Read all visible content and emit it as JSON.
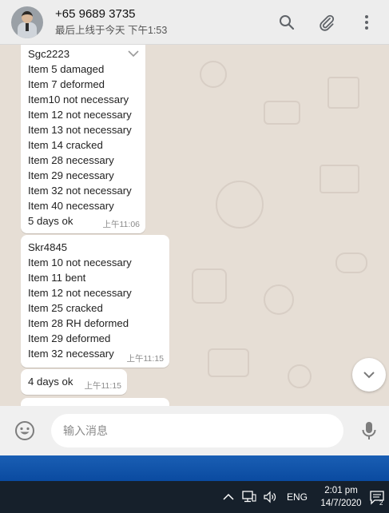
{
  "header": {
    "contact_name": "+65 9689 3735",
    "status": "最后上线于今天 下午1:53",
    "icons": [
      "search-icon",
      "attach-icon",
      "menu-icon"
    ]
  },
  "messages": [
    {
      "lines": [
        "Sgc2223",
        "Item 5 damaged",
        "Item 7 deformed",
        "Item10 not necessary",
        "Item 12 not necessary",
        "Item 13 not necessary",
        "Item 14 cracked",
        "Item 28 necessary",
        "Item 29 necessary",
        "Item 32 not necessary",
        "Item 40 necessary",
        "5 days ok"
      ],
      "time": "上午11:06"
    },
    {
      "lines": [
        "Skr4845",
        "Item 10 not necessary",
        "Item 11 bent",
        "Item 12 not necessary",
        "Item 25 cracked",
        "Item 28 RH deformed",
        "Item 29 deformed",
        "Item 32 necessary"
      ],
      "time": "上午11:15"
    },
    {
      "lines": [
        "4 days ok"
      ],
      "time": "上午11:15"
    }
  ],
  "composer": {
    "placeholder": "输入消息"
  },
  "taskbar": {
    "language": "ENG",
    "time": "2:01 pm",
    "date": "14/7/2020",
    "notification_count": "2"
  }
}
